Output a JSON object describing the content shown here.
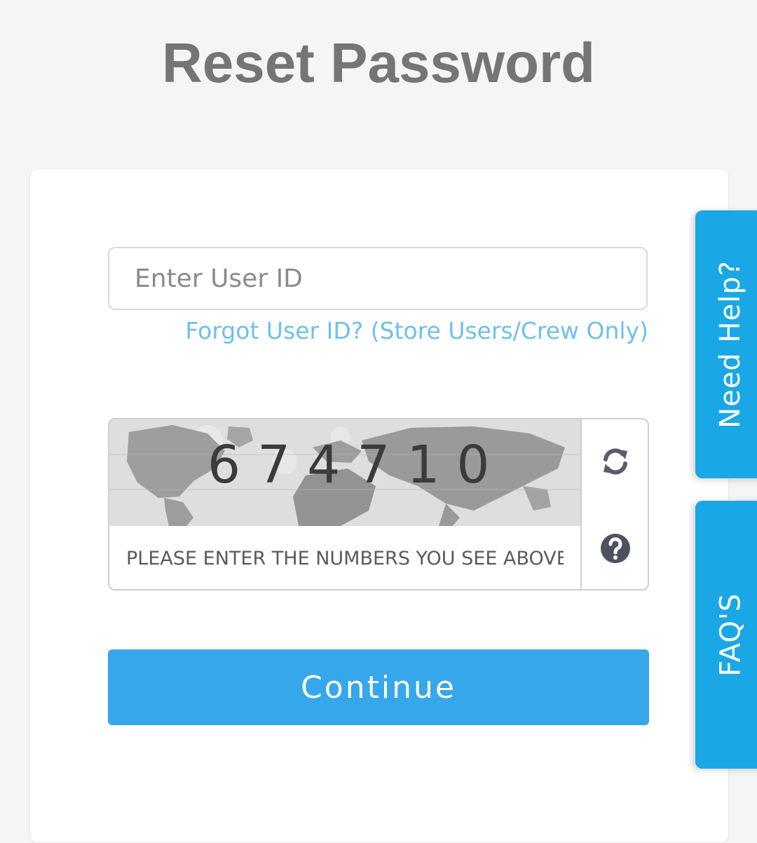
{
  "page": {
    "title": "Reset Password"
  },
  "form": {
    "user_id_placeholder": "Enter User ID",
    "user_id_value": "",
    "forgot_link": "Forgot User ID? (Store Users/Crew Only)",
    "captcha": {
      "code": "674710",
      "placeholder": "PLEASE ENTER THE NUMBERS YOU SEE ABOVE",
      "value": "",
      "refresh_icon": "refresh-icon",
      "help_icon": "question-circle-icon"
    },
    "continue_label": "Continue"
  },
  "side_tabs": {
    "need_help": "Need Help?",
    "faqs": "FAQ'S"
  },
  "colors": {
    "background": "#f5f5f6",
    "title": "#757575",
    "link": "#6fc0ea",
    "primary_button": "#36a7ea",
    "side_tab": "#1aa7e6"
  }
}
